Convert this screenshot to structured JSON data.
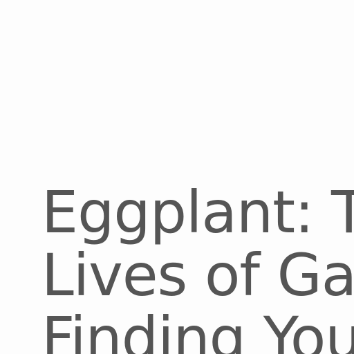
{
  "article": {
    "title_lines": [
      "Eggplant: T",
      "Lives of Ga",
      "Finding You"
    ]
  }
}
